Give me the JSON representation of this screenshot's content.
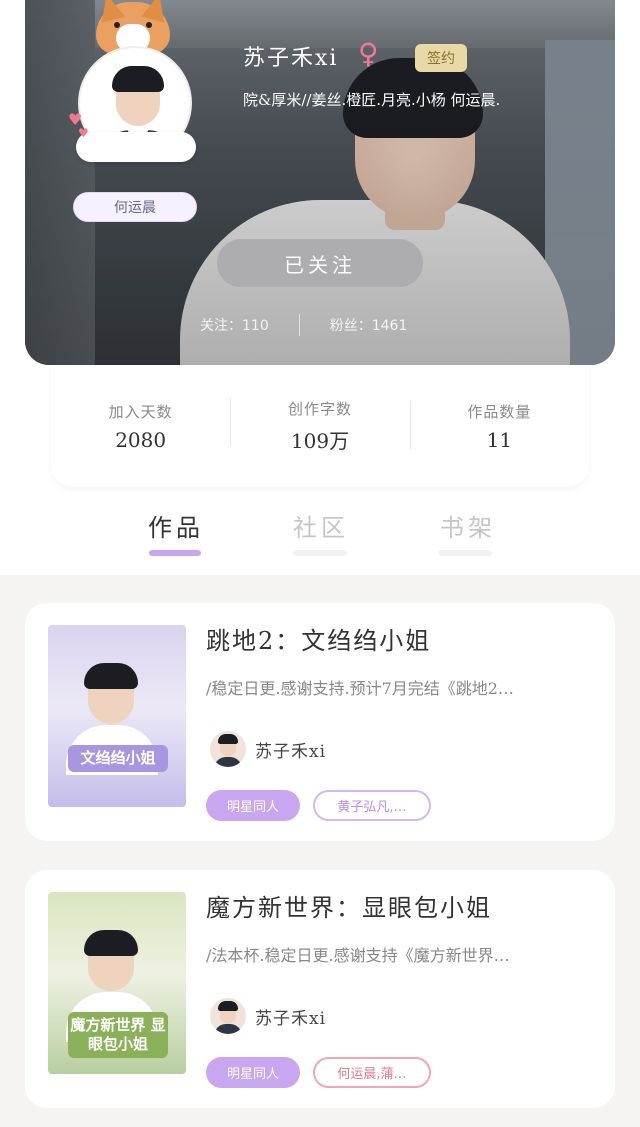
{
  "profile": {
    "username": "苏子禾xi",
    "gender_icon": "female-icon",
    "signed_badge": "签约",
    "bio": "院&厚米//姜丝.橙匠.月亮.小杨 何运晨.",
    "nickname_tag": "何运晨",
    "follow_button": "已关注",
    "following_label": "关注：110",
    "followers_label": "粉丝：1461"
  },
  "stats": [
    {
      "label": "加入天数",
      "value": "2080"
    },
    {
      "label": "创作字数",
      "value": "109万"
    },
    {
      "label": "作品数量",
      "value": "11"
    }
  ],
  "tabs": [
    {
      "label": "作品",
      "active": true
    },
    {
      "label": "社区",
      "active": false
    },
    {
      "label": "书架",
      "active": false
    }
  ],
  "colors": {
    "accent_purple": "#c8a6f0",
    "female_pink": "#f07a92",
    "signed_gold": "#e9d9a6"
  },
  "books": [
    {
      "title": "跳地2：文绉绉小姐",
      "description": "/稳定日更.感谢支持.预计7月完结《跳地2…",
      "author": "苏子禾xi",
      "cover_title": "文绉绉小姐",
      "tags": [
        "明星同人",
        "黄子弘凡,…"
      ]
    },
    {
      "title": "魔方新世界：显眼包小姐",
      "description": "/法本杯.稳定日更.感谢支持《魔方新世界…",
      "author": "苏子禾xi",
      "cover_title": "魔方新世界 显眼包小姐",
      "tags": [
        "明星同人",
        "何运晨,蒲…"
      ]
    }
  ]
}
